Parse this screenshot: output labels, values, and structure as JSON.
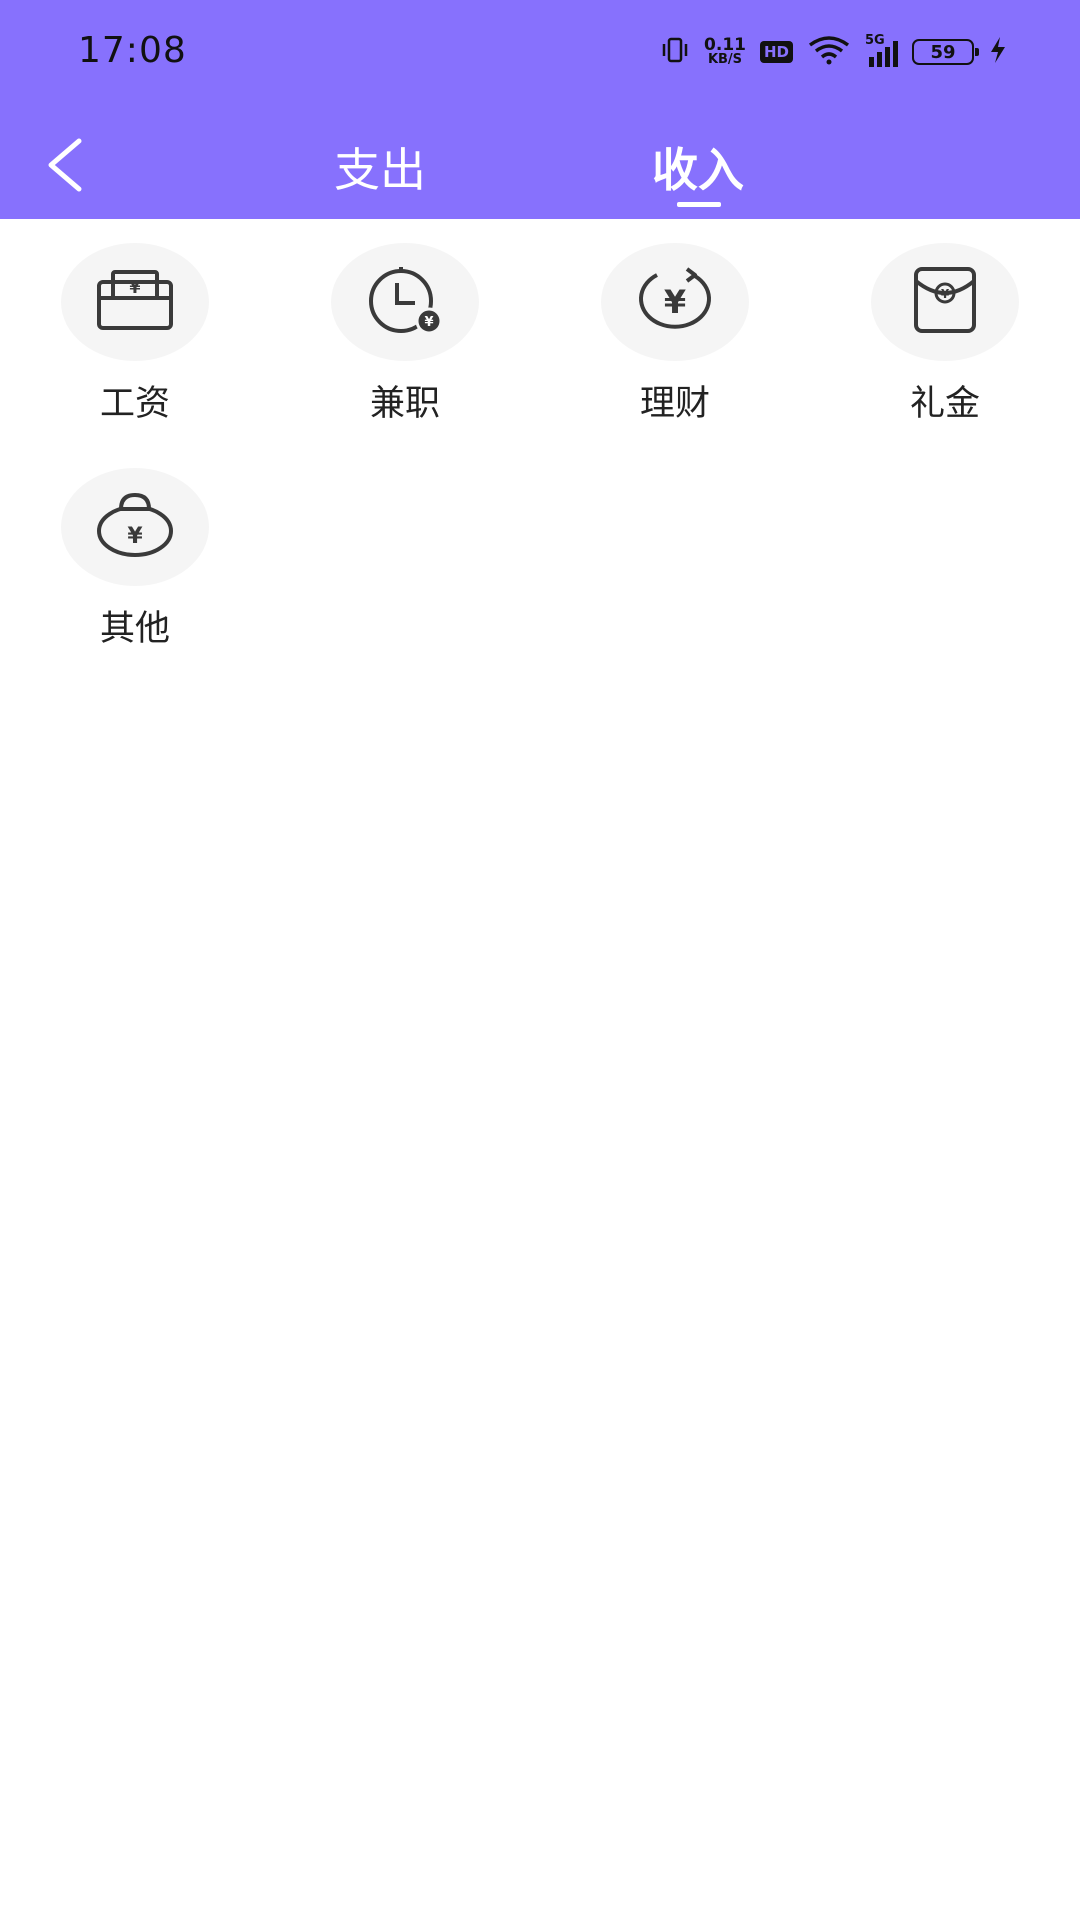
{
  "status_bar": {
    "time": "17:08",
    "net_speed_value": "0.11",
    "net_speed_unit": "KB/S",
    "hd_label": "HD",
    "network_label": "5G",
    "battery_level": "59"
  },
  "nav": {
    "back_icon": "chevron-left-icon",
    "tabs": [
      {
        "label": "支出",
        "selected": false
      },
      {
        "label": "收入",
        "selected": true
      }
    ]
  },
  "colors": {
    "header_bg": "#8771fd",
    "icon_circle_bg": "#f5f5f5",
    "icon_stroke": "#3a3a3a"
  },
  "categories": [
    {
      "label": "工资",
      "icon": "wallet-yuan-icon"
    },
    {
      "label": "兼职",
      "icon": "clock-yuan-icon"
    },
    {
      "label": "理财",
      "icon": "yuan-refresh-icon"
    },
    {
      "label": "礼金",
      "icon": "red-envelope-icon"
    },
    {
      "label": "其他",
      "icon": "money-bag-icon"
    }
  ]
}
